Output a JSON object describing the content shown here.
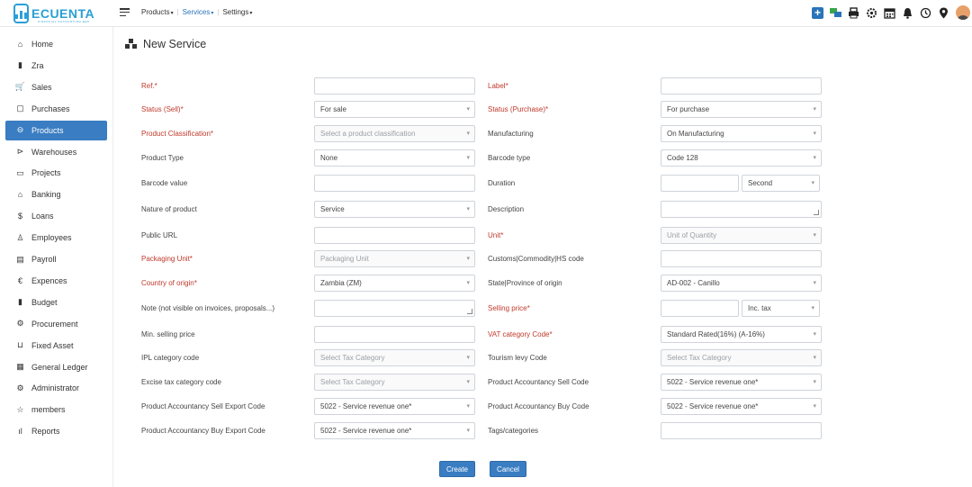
{
  "app": {
    "logo_text": "ECUENTA",
    "logo_sub": "FINANCIAL ACCOUNTING ERP"
  },
  "topmenu": [
    {
      "label": "Products",
      "active": false
    },
    {
      "label": "Services",
      "active": true
    },
    {
      "label": "Settings",
      "active": false
    }
  ],
  "topicons": [
    "plus-icon",
    "chat-icon",
    "printer-icon",
    "gear-icon",
    "calendar-icon",
    "bell-icon",
    "history-icon",
    "location-icon",
    "user-avatar"
  ],
  "sidebar": [
    {
      "label": "Home",
      "icon": "⌂",
      "name": "home"
    },
    {
      "label": "Zra",
      "icon": "▮",
      "name": "zra"
    },
    {
      "label": "Sales",
      "icon": "🛒",
      "name": "sales"
    },
    {
      "label": "Purchases",
      "icon": "▢",
      "name": "purchases"
    },
    {
      "label": "Products",
      "icon": "⊖",
      "name": "products",
      "active": true
    },
    {
      "label": "Warehouses",
      "icon": "⊳",
      "name": "warehouses"
    },
    {
      "label": "Projects",
      "icon": "▭",
      "name": "projects"
    },
    {
      "label": "Banking",
      "icon": "⌂",
      "name": "banking"
    },
    {
      "label": "Loans",
      "icon": "$",
      "name": "loans"
    },
    {
      "label": "Employees",
      "icon": "♙",
      "name": "employees"
    },
    {
      "label": "Payroll",
      "icon": "▤",
      "name": "payroll"
    },
    {
      "label": "Expences",
      "icon": "€",
      "name": "expences"
    },
    {
      "label": "Budget",
      "icon": "▮",
      "name": "budget"
    },
    {
      "label": "Procurement",
      "icon": "⚙",
      "name": "procurement"
    },
    {
      "label": "Fixed Asset",
      "icon": "⊔",
      "name": "fixed-asset"
    },
    {
      "label": "General Ledger",
      "icon": "▦",
      "name": "general-ledger"
    },
    {
      "label": "Administrator",
      "icon": "⚙",
      "name": "administrator"
    },
    {
      "label": "members",
      "icon": "☆",
      "name": "members"
    },
    {
      "label": "Reports",
      "icon": "ıl",
      "name": "reports"
    }
  ],
  "page_title": "New Service",
  "form": {
    "left": [
      {
        "label": "Ref.*",
        "required": true,
        "type": "text",
        "value": ""
      },
      {
        "label": "Status (Sell)*",
        "required": true,
        "type": "select",
        "value": "For sale"
      },
      {
        "label": "Product Classification*",
        "required": true,
        "type": "select",
        "value": "Select a product classification",
        "placeholder": true
      },
      {
        "label": "Product Type",
        "required": false,
        "type": "select",
        "value": "None"
      },
      {
        "label": "Barcode value",
        "required": false,
        "type": "text",
        "value": ""
      },
      {
        "label": "Nature of product",
        "required": false,
        "type": "select",
        "value": "Service"
      },
      {
        "label": "Public URL",
        "required": false,
        "type": "text",
        "value": ""
      },
      {
        "label": "Packaging Unit*",
        "required": true,
        "type": "select",
        "value": "Packaging Unit",
        "placeholder": true
      },
      {
        "label": "Country of origin*",
        "required": true,
        "type": "select",
        "value": "Zambia (ZM)"
      },
      {
        "label": "Note (not visible on invoices, proposals...)",
        "required": false,
        "type": "textarea",
        "value": ""
      },
      {
        "label": "Min. selling price",
        "required": false,
        "type": "text",
        "value": ""
      },
      {
        "label": "IPL category code",
        "required": false,
        "type": "select",
        "value": "Select Tax Category",
        "placeholder": true
      },
      {
        "label": "Excise tax category code",
        "required": false,
        "type": "select",
        "value": "Select Tax Category",
        "placeholder": true
      },
      {
        "label": "Product Accountancy Sell Export Code",
        "required": false,
        "type": "select",
        "value": "5022 - Service revenue one*"
      },
      {
        "label": "Product Accountancy Buy Export Code",
        "required": false,
        "type": "select",
        "value": "5022 - Service revenue one*"
      }
    ],
    "right": [
      {
        "label": "Label*",
        "required": true,
        "type": "text",
        "value": ""
      },
      {
        "label": "Status (Purchase)*",
        "required": true,
        "type": "select",
        "value": "For purchase"
      },
      {
        "label": "Manufacturing",
        "required": false,
        "type": "select",
        "value": "On Manufacturing"
      },
      {
        "label": "Barcode type",
        "required": false,
        "type": "select",
        "value": "Code 128"
      },
      {
        "label": "Duration",
        "required": false,
        "type": "split",
        "value": "",
        "unit": "Second"
      },
      {
        "label": "Description",
        "required": false,
        "type": "textarea",
        "value": ""
      },
      {
        "label": "Unit*",
        "required": true,
        "type": "select",
        "value": "Unit of Quantity",
        "placeholder": true
      },
      {
        "label": "Customs|Commodity|HS code",
        "required": false,
        "type": "text",
        "value": ""
      },
      {
        "label": "State|Province of origin",
        "required": false,
        "type": "select",
        "value": "AD-002 - Canillo"
      },
      {
        "label": "Selling price*",
        "required": true,
        "type": "split",
        "value": "",
        "unit": "Inc. tax"
      },
      {
        "label": "VAT category Code*",
        "required": true,
        "type": "select",
        "value": "Standard Rated(16%) (A-16%)"
      },
      {
        "label": "Tourism levy Code",
        "required": false,
        "type": "select",
        "value": "Select Tax Category",
        "placeholder": true
      },
      {
        "label": "Product Accountancy Sell Code",
        "required": false,
        "type": "select",
        "value": "5022 - Service revenue one*"
      },
      {
        "label": "Product Accountancy Buy Code",
        "required": false,
        "type": "select",
        "value": "5022 - Service revenue one*"
      },
      {
        "label": "Tags/categories",
        "required": false,
        "type": "text",
        "value": ""
      }
    ]
  },
  "buttons": {
    "create": "Create",
    "cancel": "Cancel"
  },
  "colors": {
    "accent": "#3a7dc2",
    "required_label": "#c0392b",
    "brand": "#2a9fd6"
  }
}
